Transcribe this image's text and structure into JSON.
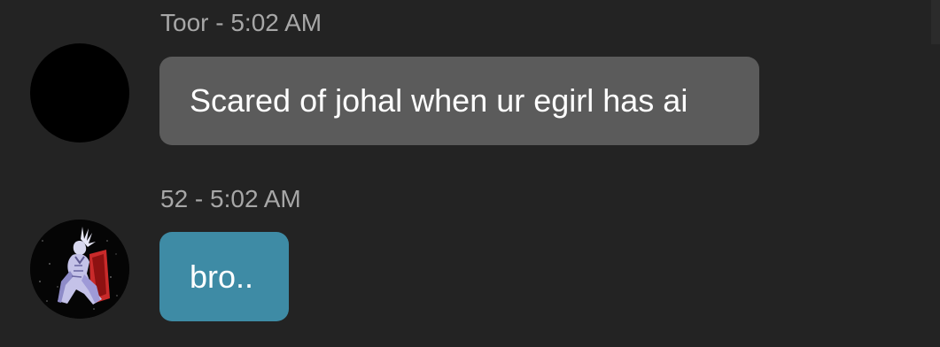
{
  "conversation": {
    "messages": [
      {
        "author": "Toor",
        "time": "5:02 AM",
        "header": "Toor - 5:02 AM",
        "avatar": "black-circle-avatar",
        "text": "Scared of johal when ur egirl has ai",
        "bubble_color": "#5b5b5b"
      },
      {
        "author": "52",
        "time": "5:02 AM",
        "header": "52 - 5:02 AM",
        "avatar": "seated-figure-on-red-throne-avatar",
        "text": "bro..",
        "bubble_color": "#3e8ba5"
      }
    ]
  },
  "theme": {
    "background": "#232323",
    "meta_text_color": "#a7a7a7",
    "message_text_color": "#ffffff"
  }
}
